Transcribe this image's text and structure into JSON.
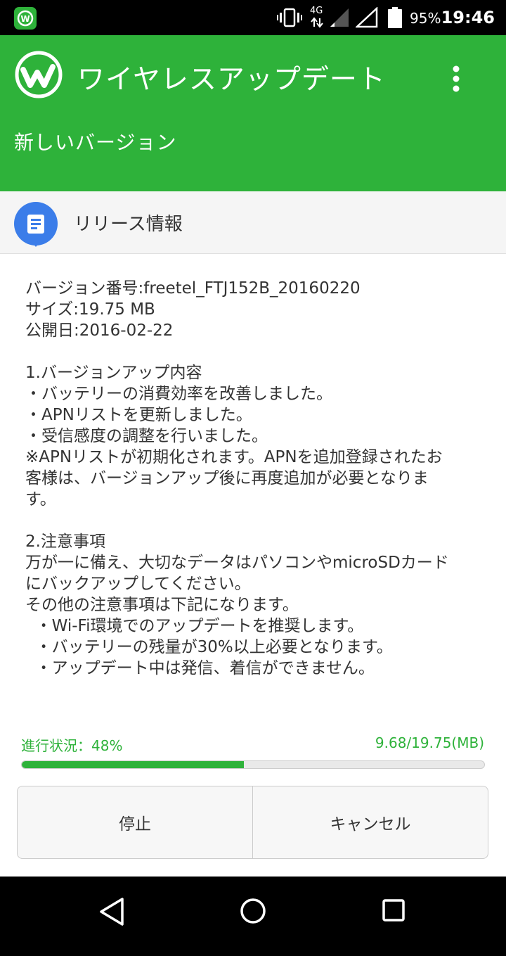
{
  "status_bar": {
    "battery_percent": "95%",
    "time": "19:46",
    "network_label": "4G"
  },
  "app_bar": {
    "title": "ワイヤレスアップデート",
    "subtitle": "新しいバージョン"
  },
  "section": {
    "title": "リリース情報"
  },
  "release_notes": {
    "lines": [
      "バージョン番号:freetel_FTJ152B_20160220",
      "サイズ:19.75 MB",
      "公開日:2016-02-22",
      "",
      "1.バージョンアップ内容",
      "・バッテリーの消費効率を改善しました。",
      "・APNリストを更新しました。",
      "・受信感度の調整を行いました。",
      "※APNリストが初期化されます。APNを追加登録されたお",
      "客様は、バージョンアップ後に再度追加が必要となりま",
      "す。",
      "",
      "2.注意事項",
      "万が一に備え、大切なデータはパソコンやmicroSDカード",
      "にバックアップしてください。",
      "その他の注意事項は下記になります。",
      "  ・Wi-Fi環境でのアップデートを推奨します。",
      "  ・バッテリーの残量が30%以上必要となります。",
      "  ・アップデート中は発信、着信ができません。"
    ]
  },
  "progress": {
    "label": "進行状況：48%",
    "size_text": "9.68/19.75(MB)",
    "fraction": 0.48
  },
  "buttons": {
    "stop": "停止",
    "cancel": "キャンセル"
  },
  "colors": {
    "accent": "#2eb23a",
    "section_icon": "#3b7de9"
  }
}
